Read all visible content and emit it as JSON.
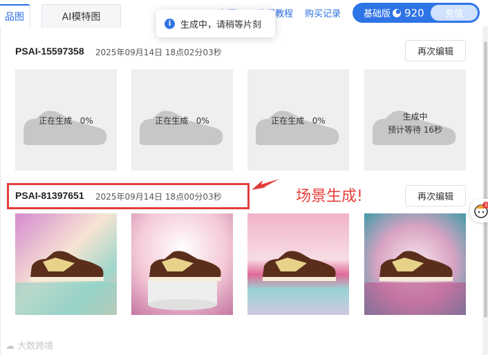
{
  "tabs": [
    {
      "label": "品图"
    },
    {
      "label": "AI模特图"
    }
  ],
  "top_links": {
    "partial": "◆ 在顶",
    "tutorial": "使用教程",
    "records": "购买记录"
  },
  "plan": {
    "label": "基础版",
    "points": "920",
    "recharge": "充值"
  },
  "toast": {
    "icon": "info-icon",
    "message": "生成中，请稍等片刻"
  },
  "groups": [
    {
      "id": "PSAI-15597358",
      "time": "2025年09月14日 18点02分03秒",
      "reedit": "再次编辑",
      "items": [
        {
          "line1": "正在生成",
          "line2": "0%"
        },
        {
          "line1": "正在生成",
          "line2": "0%"
        },
        {
          "line1": "正在生成",
          "line2": "0%"
        },
        {
          "line1": "生成中",
          "line2": "预计等待  16秒"
        }
      ]
    },
    {
      "id": "PSAI-81397651",
      "time": "2025年09月14日 18点00分03秒",
      "reedit": "再次编辑",
      "items": [
        {
          "scene": "sneaker-on-blue-yellow-gradient"
        },
        {
          "scene": "sneaker-on-white-pedestal"
        },
        {
          "scene": "sneaker-on-pink-teal-gradient"
        },
        {
          "scene": "sneaker-on-teal-magenta-gradient"
        }
      ]
    }
  ],
  "annotation": {
    "text": "场景生成!",
    "color": "#e33b3b"
  },
  "assistant_badge": "3",
  "watermark": "大数跨境",
  "colors": {
    "accent": "#2f74e6",
    "placeholder_bg": "#efefef",
    "annotation_red": "#e33b3b"
  }
}
